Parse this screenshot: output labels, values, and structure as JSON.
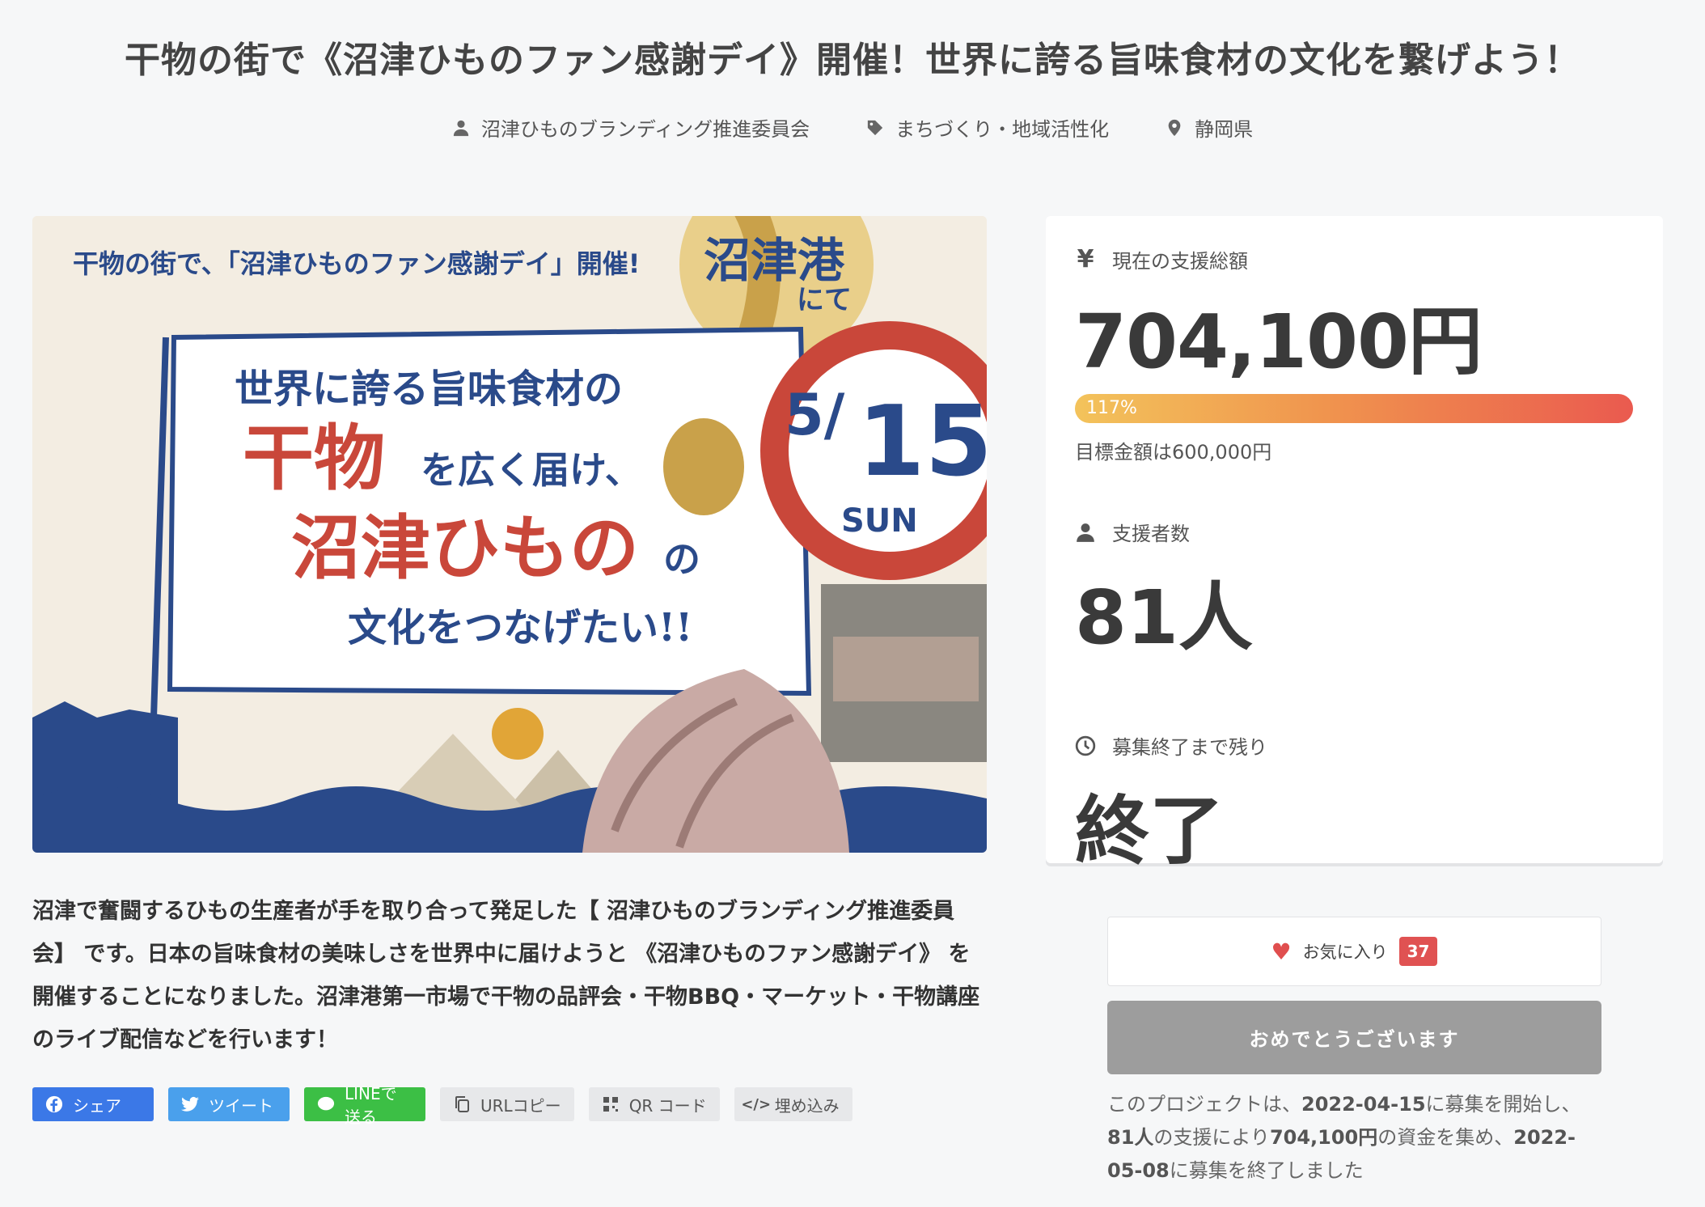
{
  "page": {
    "title": "干物の街で《沼津ひものファン感謝デイ》開催！世界に誇る旨味食材の文化を繋げよう！"
  },
  "meta": {
    "owner": "沼津ひものブランディング推進委員会",
    "category": "まちづくり・地域活性化",
    "location": "静岡県"
  },
  "hero": {
    "top_text": "干物の街で、「沼津ひものファン感謝デイ」開催!",
    "place": "沼津港",
    "place_sub": "にて",
    "line1": "世界に誇る旨味食材の",
    "line2": "干物",
    "line2b": "を広く届け、",
    "line3": "沼津ひもの",
    "line3b": "の",
    "line4": "文化をつなげたい!!",
    "date_month": "5/",
    "date_day": "15",
    "date_dow": "SUN"
  },
  "stats": {
    "total_label": "現在の支援総額",
    "total_icon": "yen-icon",
    "total": "704,100円",
    "progress_label": "117%",
    "progress_pct": 117,
    "goal": "目標金額は600,000円",
    "supporters_label": "支援者数",
    "supporters": "81人",
    "remaining_label": "募集終了まで残り",
    "remaining": "終了"
  },
  "description": "沼津で奮闘するひもの生産者が手を取り合って発足した【 沼津ひものブランディング推進委員会】 です。日本の旨味食材の美味しさを世界中に届けようと 《沼津ひものファン感謝デイ》 を開催することになりました。沼津港第一市場で干物の品評会・干物BBQ・マーケット・干物講座のライブ配信などを行います！",
  "share": {
    "facebook": "シェア",
    "twitter": "ツイート",
    "line": "LINEで送る",
    "url": "URLコピー",
    "qr": "QR コード",
    "embed": "埋め込み"
  },
  "actions": {
    "favorite": "お気に入り",
    "favorite_count": "37",
    "status_button": "おめでとうございます"
  },
  "summary": {
    "p1": "このプロジェクトは、",
    "start": "2022-04-15",
    "p2": "に募集を開始し、",
    "count": "81人",
    "p3": "の支援により",
    "amount": "704,100円",
    "p4": "の資金を集め、",
    "end": "2022-05-08",
    "p5": "に募集を終了しました"
  },
  "colors": {
    "accent_red": "#e05252",
    "hero_navy": "#2a4a8a",
    "hero_red": "#c9473a",
    "hero_gold": "#c9a14a"
  }
}
